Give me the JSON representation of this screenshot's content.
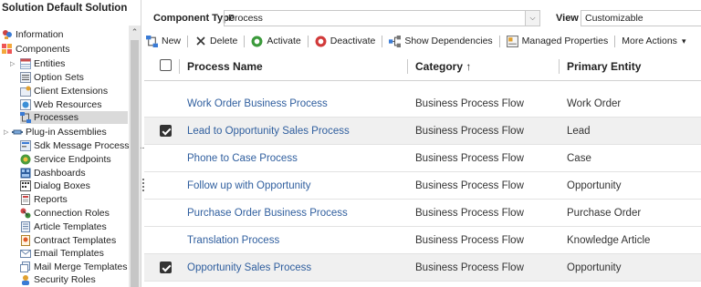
{
  "sidebar": {
    "title": "Solution Default Solution",
    "items": [
      {
        "label": "Information",
        "icon": "information-icon"
      },
      {
        "label": "Components",
        "icon": "components-icon"
      },
      {
        "label": "Entities",
        "icon": "entities-icon"
      },
      {
        "label": "Option Sets",
        "icon": "option-sets-icon"
      },
      {
        "label": "Client Extensions",
        "icon": "client-extensions-icon"
      },
      {
        "label": "Web Resources",
        "icon": "web-resources-icon"
      },
      {
        "label": "Processes",
        "icon": "processes-icon"
      },
      {
        "label": "Plug-in Assemblies",
        "icon": "plugin-assemblies-icon"
      },
      {
        "label": "Sdk Message Processin...",
        "icon": "sdk-message-icon"
      },
      {
        "label": "Service Endpoints",
        "icon": "service-endpoints-icon"
      },
      {
        "label": "Dashboards",
        "icon": "dashboards-icon"
      },
      {
        "label": "Dialog Boxes",
        "icon": "dialog-boxes-icon"
      },
      {
        "label": "Reports",
        "icon": "reports-icon"
      },
      {
        "label": "Connection Roles",
        "icon": "connection-roles-icon"
      },
      {
        "label": "Article Templates",
        "icon": "article-templates-icon"
      },
      {
        "label": "Contract Templates",
        "icon": "contract-templates-icon"
      },
      {
        "label": "Email Templates",
        "icon": "email-templates-icon"
      },
      {
        "label": "Mail Merge Templates",
        "icon": "mail-merge-templates-icon"
      },
      {
        "label": "Security Roles",
        "icon": "security-roles-icon"
      }
    ],
    "selected": "Processes"
  },
  "filters": {
    "component_type_label": "Component Type",
    "component_type_value": "Process",
    "view_label": "View",
    "view_value": "Customizable"
  },
  "toolbar": {
    "new": "New",
    "delete": "Delete",
    "activate": "Activate",
    "deactivate": "Deactivate",
    "show_dependencies": "Show Dependencies",
    "managed_properties": "Managed Properties",
    "more_actions": "More Actions",
    "more_actions_caret": "▾"
  },
  "grid": {
    "columns": {
      "name": "Process Name",
      "category": "Category ↑",
      "entity": "Primary Entity"
    },
    "rows": [
      {
        "name": "Work Order Business Process",
        "category": "Business Process Flow",
        "entity": "Work Order",
        "checked": false
      },
      {
        "name": "Lead to Opportunity Sales Process",
        "category": "Business Process Flow",
        "entity": "Lead",
        "checked": true
      },
      {
        "name": "Phone to Case Process",
        "category": "Business Process Flow",
        "entity": "Case",
        "checked": false
      },
      {
        "name": "Follow up with Opportunity",
        "category": "Business Process Flow",
        "entity": "Opportunity",
        "checked": false
      },
      {
        "name": "Purchase Order Business Process",
        "category": "Business Process Flow",
        "entity": "Purchase Order",
        "checked": false
      },
      {
        "name": "Translation Process",
        "category": "Business Process Flow",
        "entity": "Knowledge Article",
        "checked": false
      },
      {
        "name": "Opportunity Sales Process",
        "category": "Business Process Flow",
        "entity": "Opportunity",
        "checked": true
      }
    ]
  },
  "colors": {
    "link": "#2f5e9e",
    "selected_row": "#f0f0f0",
    "sidebar_selected": "#dadada"
  }
}
